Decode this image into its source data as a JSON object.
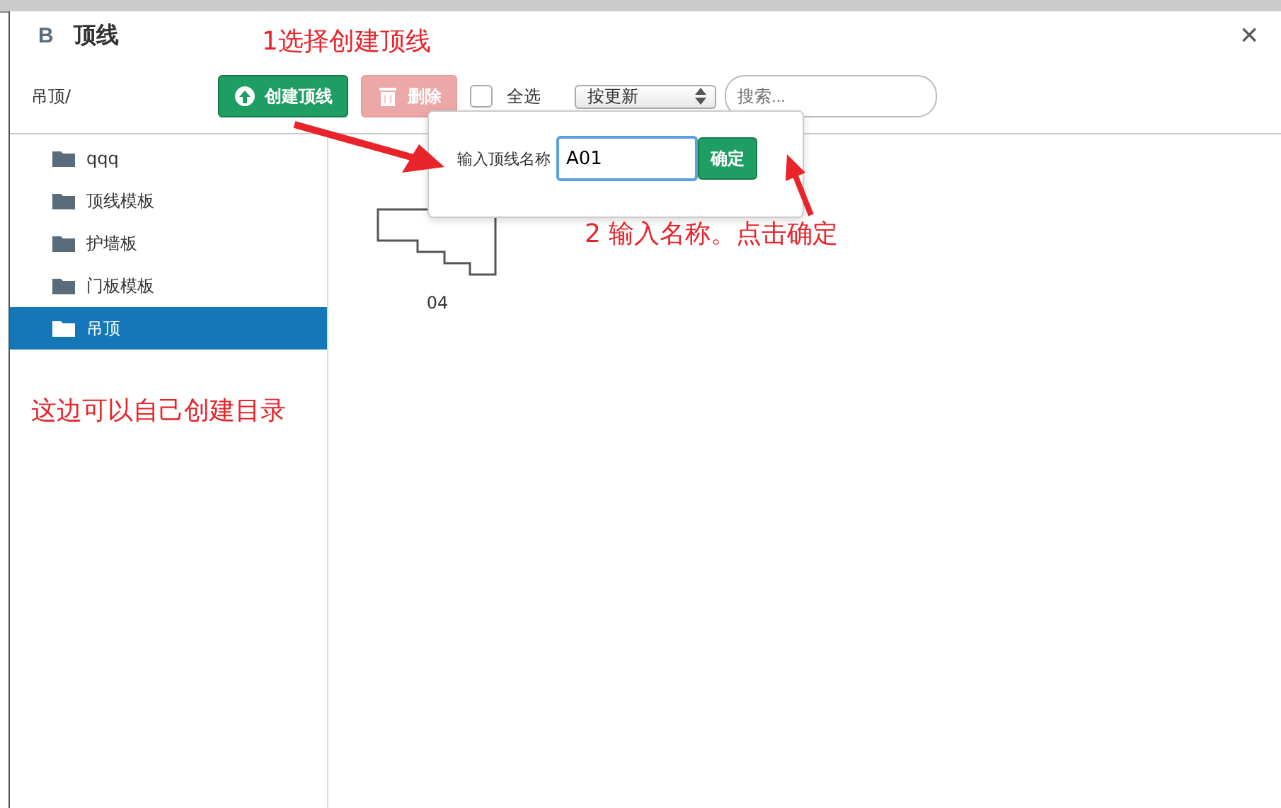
{
  "dialog": {
    "logo": "B",
    "title": "顶线",
    "close": "×"
  },
  "toolbar": {
    "breadcrumb": "吊顶/",
    "buttons": [
      {
        "kind": "create",
        "label": "创建顶线",
        "disabled": false
      },
      {
        "kind": "delete",
        "label": "删除",
        "disabled": true
      }
    ],
    "select_all": {
      "label": "全选",
      "checked": false
    },
    "sort": {
      "value": "按更新"
    },
    "search": {
      "placeholder": "搜索..."
    }
  },
  "folders": [
    {
      "name": "qqq",
      "selected": false
    },
    {
      "name": "顶线模板",
      "selected": false
    },
    {
      "name": "护墙板",
      "selected": false
    },
    {
      "name": "门板模板",
      "selected": false
    },
    {
      "name": "吊顶",
      "selected": true
    }
  ],
  "items": [
    {
      "name": "04"
    }
  ],
  "popover": {
    "label": "输入顶线名称",
    "value": "A01",
    "button": "确定"
  },
  "annotations": [
    {
      "kind": "step1",
      "text": "1选择创建顶线"
    },
    {
      "kind": "step2",
      "text": "2 输入名称。点击确定"
    },
    {
      "kind": "note",
      "text": "这边可以自己创建目录"
    }
  ]
}
